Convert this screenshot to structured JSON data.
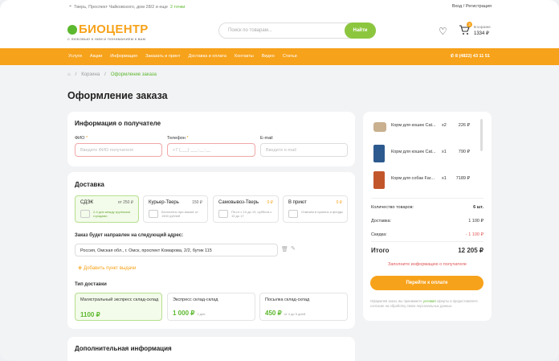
{
  "topbar": {
    "location_prefix": "Тверь, Проспект Чайковского, дом 28/2 и еще",
    "location_link": "2 точки",
    "auth": "Вход / Регистрация"
  },
  "header": {
    "logo_name": "БИОЦЕНТР",
    "logo_tagline": "С ЛЮБОВЬЮ К НИМ И ПОНИМАНИЕМ К ВАМ",
    "search_placeholder": "Поиск по товарам...",
    "search_button": "Найти",
    "cart_badge": "3",
    "cart_label": "В корзине",
    "cart_sum": "1334 ₽"
  },
  "nav": {
    "items": [
      "Услуги",
      "Акции",
      "Информация",
      "Заказать и принт",
      "Доставка и оплата",
      "Контакты",
      "Видео",
      "Статьи"
    ],
    "phone": "8 (4822) 43 11 51"
  },
  "breadcrumbs": [
    "Корзина",
    "Оформление заказа"
  ],
  "page_title": "Оформление заказа",
  "recipient": {
    "title": "Информация о получателе",
    "name_label": "ФИО",
    "name_placeholder": "Введите ФИО получателя",
    "phone_label": "Телефон",
    "phone_placeholder": "+7 (___) ___-__-__",
    "email_label": "E-mail",
    "email_placeholder": "Введите e-mail"
  },
  "delivery": {
    "title": "Доставка",
    "options": [
      {
        "name": "СДЭК",
        "price": "от 250 ₽",
        "desc": "2-4 дня между крупными городами"
      },
      {
        "name": "Курьер-Тверь",
        "price": "150 ₽",
        "desc": "Бесплатно при заказе от 1500 рублей"
      },
      {
        "name": "Самовывоз-Тверь",
        "price": "0 ₽",
        "desc": "Пн-пт с 10 до 19, суббота с 10 до 17"
      },
      {
        "name": "В приют",
        "price": "0 ₽",
        "desc": "Отвезем в приюты и фонды"
      }
    ],
    "address_label": "Заказ будет направлен на следующий адрес:",
    "address_value": "Россия, Омская обл., г. Омск, проспект Комарова, 2/2, бутик 115",
    "add_point": "Добавить пункт выдачи",
    "type_label": "Тип доставки",
    "types": [
      {
        "name": "Магистральный экспресс склад-склад",
        "price": "1100 ₽",
        "days": ""
      },
      {
        "name": "Экспресс склад-склад",
        "price": "1 000 ₽",
        "days": "2 дня"
      },
      {
        "name": "Посылка склад-склад",
        "price": "450 ₽",
        "days": "от 4 до 5 дней"
      }
    ]
  },
  "additional": {
    "title": "Дополнительная информация"
  },
  "summary": {
    "items": [
      {
        "name": "Корм для кошек Cat...",
        "qty": "x2",
        "price": "226 ₽",
        "color": "#c9b08f"
      },
      {
        "name": "Корм для кошек Cat...",
        "qty": "x1",
        "price": "790 ₽",
        "color": "#2d5a8e"
      },
      {
        "name": "Корм для собак Far...",
        "qty": "x1",
        "price": "7189 ₽",
        "color": "#c2562b"
      }
    ],
    "count_label": "Количество товаров:",
    "count_value": "6 шт.",
    "delivery_label": "Доставка:",
    "delivery_value": "1 100 ₽",
    "discount_label": "Скидка:",
    "discount_value": "- 1 100 ₽",
    "total_label": "Итого",
    "total_value": "12 205 ₽",
    "fill_hint": "Заполните информацию о получателе",
    "pay_button": "Перейти к оплате",
    "agree_prefix": "Оформляя заказ, вы принимаете",
    "agree_link": "условия",
    "agree_suffix": "оферты и предоставляете согласие на обработку своих персональных данных"
  },
  "colors": {
    "orange": "#f7a21b",
    "green": "#5cb82e"
  }
}
